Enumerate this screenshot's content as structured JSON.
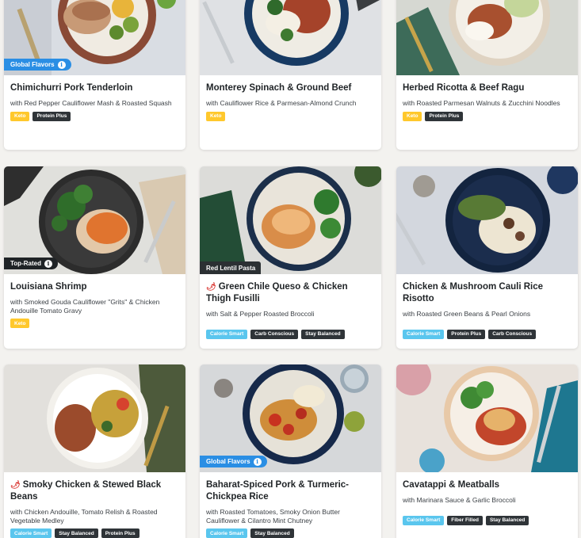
{
  "cards": [
    {
      "title": "Chimichurri Pork Tenderloin",
      "subtitle": "with Red Pepper Cauliflower Mash & Roasted Squash",
      "flag": "Global Flavors",
      "tags": [
        "Keto",
        "Protein Plus"
      ],
      "spicy": false
    },
    {
      "title": "Monterey Spinach & Ground Beef",
      "subtitle": "with Cauliflower Rice & Parmesan-Almond Crunch",
      "flag": "",
      "tags": [
        "Keto"
      ],
      "spicy": false
    },
    {
      "title": "Herbed Ricotta & Beef Ragu",
      "subtitle": "with Roasted Parmesan Walnuts & Zucchini Noodles",
      "flag": "",
      "tags": [
        "Keto",
        "Protein Plus"
      ],
      "spicy": false
    },
    {
      "title": "Louisiana Shrimp",
      "subtitle": "with Smoked Gouda Cauliflower \"Grits\" & Chicken Andouille Tomato Gravy",
      "flag": "Top-Rated",
      "tags": [
        "Keto"
      ],
      "spicy": false
    },
    {
      "title": "Green Chile Queso & Chicken Thigh Fusilli",
      "subtitle": "with Salt & Pepper Roasted Broccoli",
      "flag": "Red Lentil Pasta",
      "tags": [
        "Calorie Smart",
        "Carb Conscious",
        "Stay Balanced"
      ],
      "spicy": true
    },
    {
      "title": "Chicken & Mushroom Cauli Rice Risotto",
      "subtitle": "with Roasted Green Beans & Pearl Onions",
      "flag": "",
      "tags": [
        "Calorie Smart",
        "Protein Plus",
        "Carb Conscious"
      ],
      "spicy": false
    },
    {
      "title": "Smoky Chicken & Stewed Black Beans",
      "subtitle": "with Chicken Andouille, Tomato Relish & Roasted Vegetable Medley",
      "flag": "",
      "tags": [
        "Calorie Smart",
        "Stay Balanced",
        "Protein Plus"
      ],
      "spicy": true
    },
    {
      "title": "Baharat-Spiced Pork & Turmeric-Chickpea Rice",
      "subtitle": "with Roasted Tomatoes, Smoky Onion Butter Cauliflower & Cilantro Mint Chutney",
      "flag": "Global Flavors",
      "tags": [
        "Calorie Smart",
        "Stay Balanced"
      ],
      "spicy": false
    },
    {
      "title": "Cavatappi & Meatballs",
      "subtitle": "with Marinara Sauce & Garlic Broccoli",
      "flag": "",
      "tags": [
        "Calorie Smart",
        "Fiber Filled",
        "Stay Balanced"
      ],
      "spicy": false
    }
  ],
  "colors": {
    "keto": "#ffc82c",
    "calorie_smart": "#5ac6ee",
    "dark_tag": "#2f3438",
    "global_flavors": "#2a8ee4"
  }
}
